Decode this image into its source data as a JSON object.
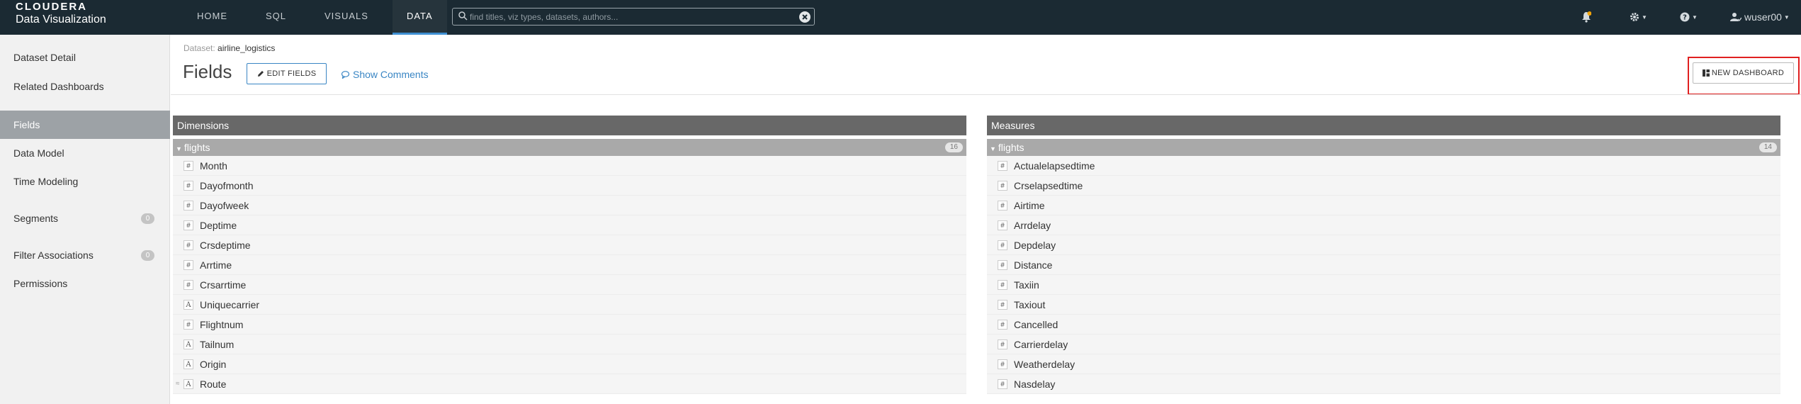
{
  "brand": {
    "logo_text": "CLOUDERA",
    "app_name": "Data Visualization"
  },
  "nav": [
    {
      "label": "HOME",
      "active": false
    },
    {
      "label": "SQL",
      "active": false
    },
    {
      "label": "VISUALS",
      "active": false
    },
    {
      "label": "DATA",
      "active": true
    }
  ],
  "search": {
    "placeholder": "find titles, viz types, datasets, authors...",
    "value": ""
  },
  "user": {
    "name": "wuser00"
  },
  "colors": {
    "topbar": "#1b2a33",
    "accent": "#3a86c4",
    "highlight": "#e02020",
    "notification": "#f0a30a"
  },
  "sidebar": {
    "items": [
      {
        "label": "Dataset Detail"
      },
      {
        "label": "Related Dashboards"
      },
      {
        "label": "Fields",
        "active": true
      },
      {
        "label": "Data Model"
      },
      {
        "label": "Time Modeling"
      },
      {
        "label": "Segments",
        "badge": "0"
      },
      {
        "label": "Filter Associations",
        "badge": "0"
      },
      {
        "label": "Permissions"
      }
    ]
  },
  "header": {
    "breadcrumb_prefix": "Dataset:",
    "dataset_name": "airline_logistics",
    "title": "Fields",
    "edit_fields_label": "EDIT FIELDS",
    "show_comments_label": "Show Comments",
    "new_dashboard_label": "NEW DASHBOARD"
  },
  "dimensions": {
    "title": "Dimensions",
    "group": "flights",
    "count": "16",
    "fields": [
      {
        "name": "Month",
        "type": "#"
      },
      {
        "name": "Dayofmonth",
        "type": "#"
      },
      {
        "name": "Dayofweek",
        "type": "#"
      },
      {
        "name": "Deptime",
        "type": "#"
      },
      {
        "name": "Crsdeptime",
        "type": "#"
      },
      {
        "name": "Arrtime",
        "type": "#"
      },
      {
        "name": "Crsarrtime",
        "type": "#"
      },
      {
        "name": "Uniquecarrier",
        "type": "A"
      },
      {
        "name": "Flightnum",
        "type": "#"
      },
      {
        "name": "Tailnum",
        "type": "A"
      },
      {
        "name": "Origin",
        "type": "A"
      },
      {
        "name": "Route",
        "type": "A"
      }
    ]
  },
  "measures": {
    "title": "Measures",
    "group": "flights",
    "count": "14",
    "fields": [
      {
        "name": "Actualelapsedtime",
        "type": "#"
      },
      {
        "name": "Crselapsedtime",
        "type": "#"
      },
      {
        "name": "Airtime",
        "type": "#"
      },
      {
        "name": "Arrdelay",
        "type": "#"
      },
      {
        "name": "Depdelay",
        "type": "#"
      },
      {
        "name": "Distance",
        "type": "#"
      },
      {
        "name": "Taxiin",
        "type": "#"
      },
      {
        "name": "Taxiout",
        "type": "#"
      },
      {
        "name": "Cancelled",
        "type": "#"
      },
      {
        "name": "Carrierdelay",
        "type": "#"
      },
      {
        "name": "Weatherdelay",
        "type": "#"
      },
      {
        "name": "Nasdelay",
        "type": "#"
      }
    ]
  }
}
